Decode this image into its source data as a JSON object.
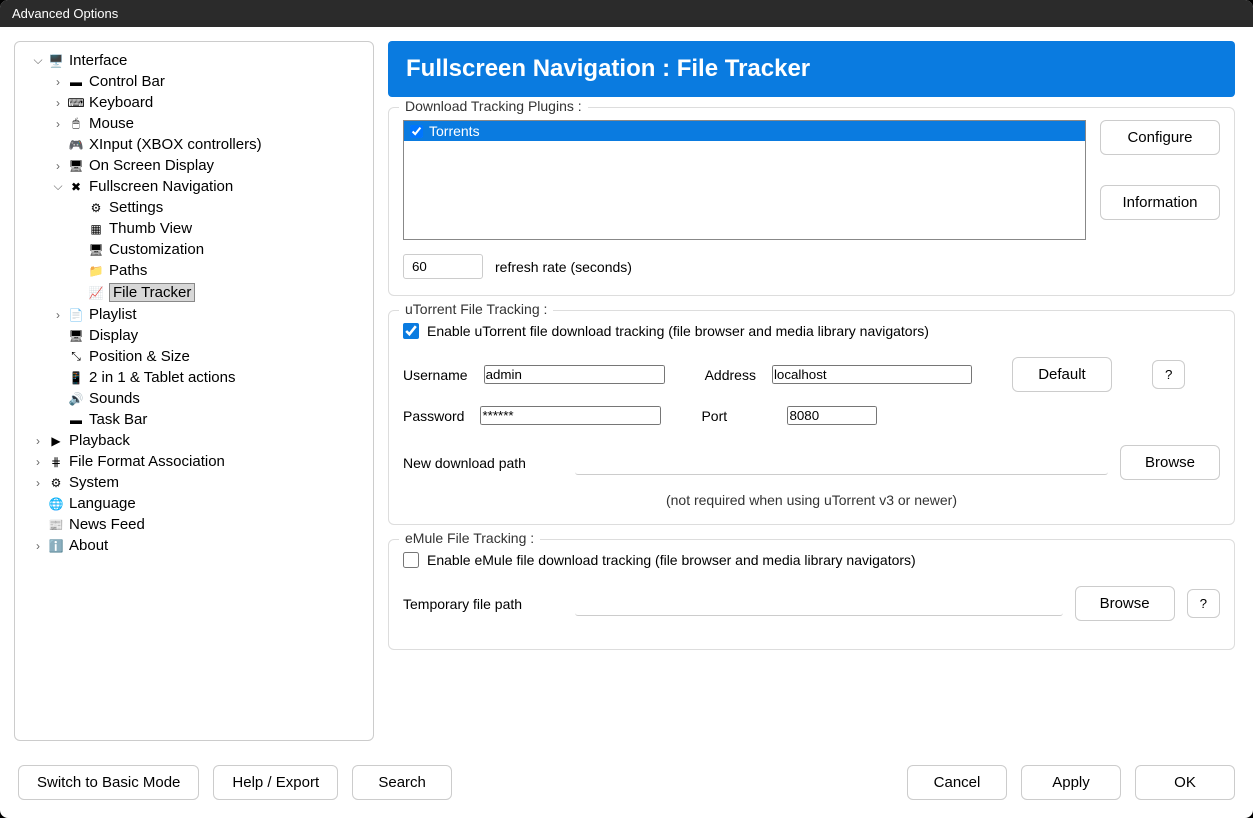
{
  "window": {
    "title": "Advanced Options"
  },
  "tree": {
    "interface": "Interface",
    "control_bar": "Control Bar",
    "keyboard": "Keyboard",
    "mouse": "Mouse",
    "xinput": "XInput (XBOX controllers)",
    "osd": "On Screen Display",
    "fullscreen_nav": "Fullscreen Navigation",
    "settings": "Settings",
    "thumb_view": "Thumb View",
    "customization": "Customization",
    "paths": "Paths",
    "file_tracker": "File Tracker",
    "playlist": "Playlist",
    "display": "Display",
    "position_size": "Position & Size",
    "tablet": "2 in 1 & Tablet actions",
    "sounds": "Sounds",
    "task_bar": "Task Bar",
    "playback": "Playback",
    "file_format": "File Format Association",
    "system": "System",
    "language": "Language",
    "news_feed": "News Feed",
    "about": "About"
  },
  "banner": "Fullscreen Navigation : File Tracker",
  "plugins": {
    "legend": "Download Tracking Plugins :",
    "items": [
      "Torrents"
    ],
    "configure": "Configure",
    "information": "Information",
    "refresh_value": "60",
    "refresh_label": "refresh rate (seconds)"
  },
  "utorrent": {
    "legend": "uTorrent File Tracking :",
    "enable_label": "Enable uTorrent file download tracking (file browser and media library navigators)",
    "username_label": "Username",
    "username_value": "admin",
    "password_label": "Password",
    "password_value": "******",
    "address_label": "Address",
    "address_value": "localhost",
    "port_label": "Port",
    "port_value": "8080",
    "default_btn": "Default",
    "help_btn": "?",
    "newpath_label": "New download path",
    "newpath_value": "",
    "browse_btn": "Browse",
    "hint": "(not required when using uTorrent v3 or newer)"
  },
  "emule": {
    "legend": "eMule File Tracking :",
    "enable_label": "Enable eMule file download tracking (file browser and media library navigators)",
    "temppath_label": "Temporary file path",
    "temppath_value": "",
    "browse_btn": "Browse",
    "help_btn": "?"
  },
  "footer": {
    "basic_mode": "Switch to Basic Mode",
    "help_export": "Help / Export",
    "search": "Search",
    "cancel": "Cancel",
    "apply": "Apply",
    "ok": "OK"
  }
}
